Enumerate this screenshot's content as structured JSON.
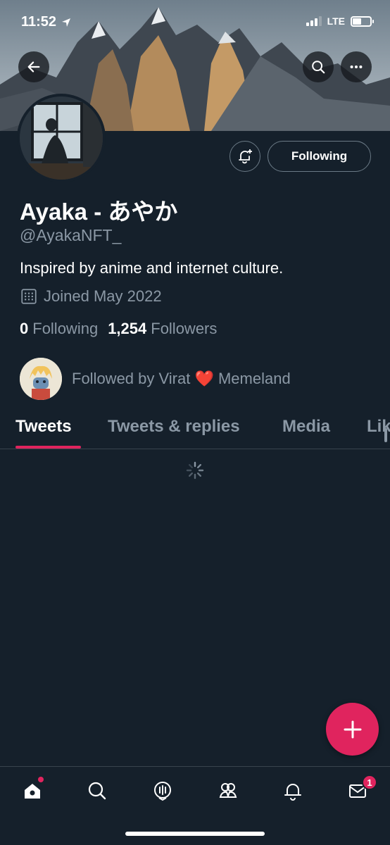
{
  "status_bar": {
    "time": "11:52",
    "network": "LTE",
    "battery_level": 0.45
  },
  "header": {
    "back_icon": "arrow-left-icon",
    "search_icon": "search-icon",
    "more_icon": "more-dots-icon"
  },
  "profile": {
    "display_name": "Ayaka - あやか",
    "handle": "@AyakaNFT_",
    "bio": "Inspired by anime and internet culture.",
    "joined": "Joined May 2022",
    "following_count": "0",
    "following_label": "Following",
    "followers_count": "1,254",
    "followers_label": "Followers",
    "followed_by": "Followed by Virat ❤️ Memeland",
    "follow_button_label": "Following"
  },
  "tabs": [
    {
      "label": "Tweets",
      "active": true
    },
    {
      "label": "Tweets & replies",
      "active": false
    },
    {
      "label": "Media",
      "active": false
    },
    {
      "label": "Likes",
      "active": false
    }
  ],
  "bottom_nav": {
    "items": [
      "home-icon",
      "search-icon",
      "spaces-icon",
      "communities-icon",
      "notifications-icon",
      "messages-icon"
    ],
    "messages_badge": "1"
  },
  "colors": {
    "accent": "#e0245e",
    "background": "#15202b",
    "muted_text": "#8b98a5",
    "divider": "#38444d"
  }
}
